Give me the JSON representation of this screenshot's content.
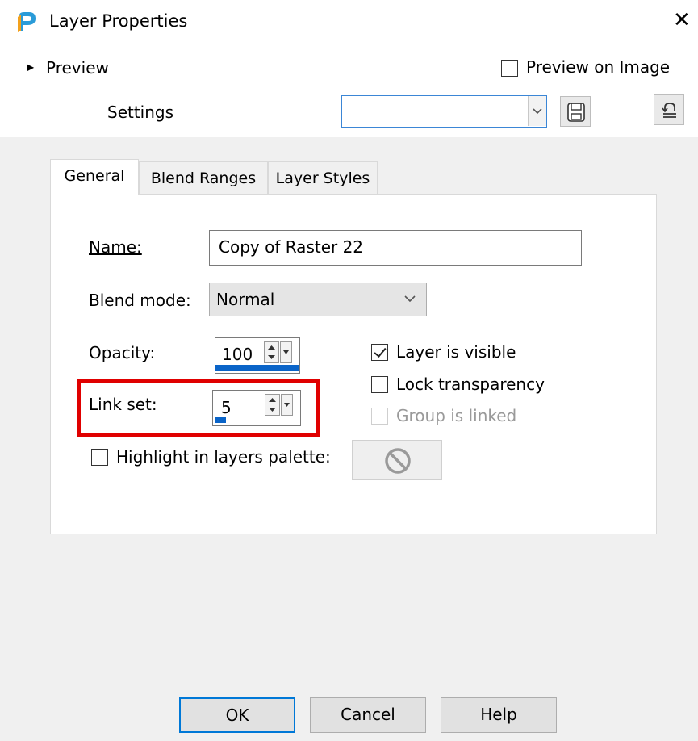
{
  "window": {
    "title": "Layer Properties",
    "close_glyph": "✕"
  },
  "preview": {
    "label": "Preview",
    "expander_glyph": "▶",
    "on_image_label": "Preview on Image",
    "on_image_checked": false
  },
  "settings": {
    "label": "Settings",
    "value": ""
  },
  "tabs": [
    {
      "label": "General",
      "active": true
    },
    {
      "label": "Blend Ranges",
      "active": false
    },
    {
      "label": "Layer Styles",
      "active": false
    }
  ],
  "general": {
    "name_label": "Name:",
    "name_value": "Copy of Raster 22",
    "blend_label": "Blend mode:",
    "blend_value": "Normal",
    "opacity_label": "Opacity:",
    "opacity_value": "100",
    "link_label": "Link set:",
    "link_value": "5",
    "layer_visible_label": "Layer is visible",
    "layer_visible_checked": true,
    "lock_transparency_label": "Lock transparency",
    "lock_transparency_checked": false,
    "group_linked_label": "Group is linked",
    "group_linked_checked": false,
    "highlight_label": "Highlight in layers palette:",
    "highlight_checked": false
  },
  "buttons": {
    "ok": "OK",
    "cancel": "Cancel",
    "help": "Help"
  },
  "colors": {
    "accent": "#0078d7",
    "highlight_frame": "#e00000",
    "panel_bg": "#f0f0f0"
  }
}
